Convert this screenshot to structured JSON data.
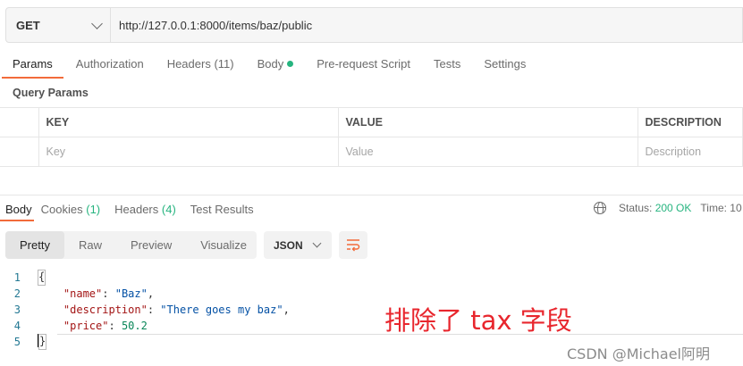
{
  "request": {
    "method": "GET",
    "url": "http://127.0.0.1:8000/items/baz/public"
  },
  "request_tabs": [
    {
      "label": "Params",
      "count": ""
    },
    {
      "label": "Authorization",
      "count": ""
    },
    {
      "label": "Headers",
      "count": "(11)"
    },
    {
      "label": "Body",
      "count": ""
    },
    {
      "label": "Pre-request Script",
      "count": ""
    },
    {
      "label": "Tests",
      "count": ""
    },
    {
      "label": "Settings",
      "count": ""
    }
  ],
  "query_params": {
    "title": "Query Params",
    "headers": {
      "key": "KEY",
      "value": "VALUE",
      "description": "DESCRIPTION"
    },
    "placeholders": {
      "key": "Key",
      "value": "Value",
      "description": "Description"
    }
  },
  "response_tabs": [
    {
      "label": "Body",
      "count": ""
    },
    {
      "label": "Cookies",
      "count": "(1)"
    },
    {
      "label": "Headers",
      "count": "(4)"
    },
    {
      "label": "Test Results",
      "count": ""
    }
  ],
  "status": {
    "label": "Status:",
    "value": "200 OK",
    "time_label": "Time: 10"
  },
  "view_modes": [
    "Pretty",
    "Raw",
    "Preview",
    "Visualize"
  ],
  "format": "JSON",
  "code_lines": [
    {
      "n": "1",
      "text": "{"
    },
    {
      "n": "2",
      "key": "\"name\"",
      "value": "\"Baz\"",
      "trail": ","
    },
    {
      "n": "3",
      "key": "\"description\"",
      "value": "\"There goes my baz\"",
      "trail": ","
    },
    {
      "n": "4",
      "key": "\"price\"",
      "value": "50.2",
      "trail": ""
    },
    {
      "n": "5",
      "text": "}"
    }
  ],
  "annotation": "排除了 tax 字段",
  "watermark": "CSDN @Michael阿明",
  "colors": {
    "accent": "#f26b3a",
    "success": "#26b47f",
    "annotation": "#e8262d"
  }
}
